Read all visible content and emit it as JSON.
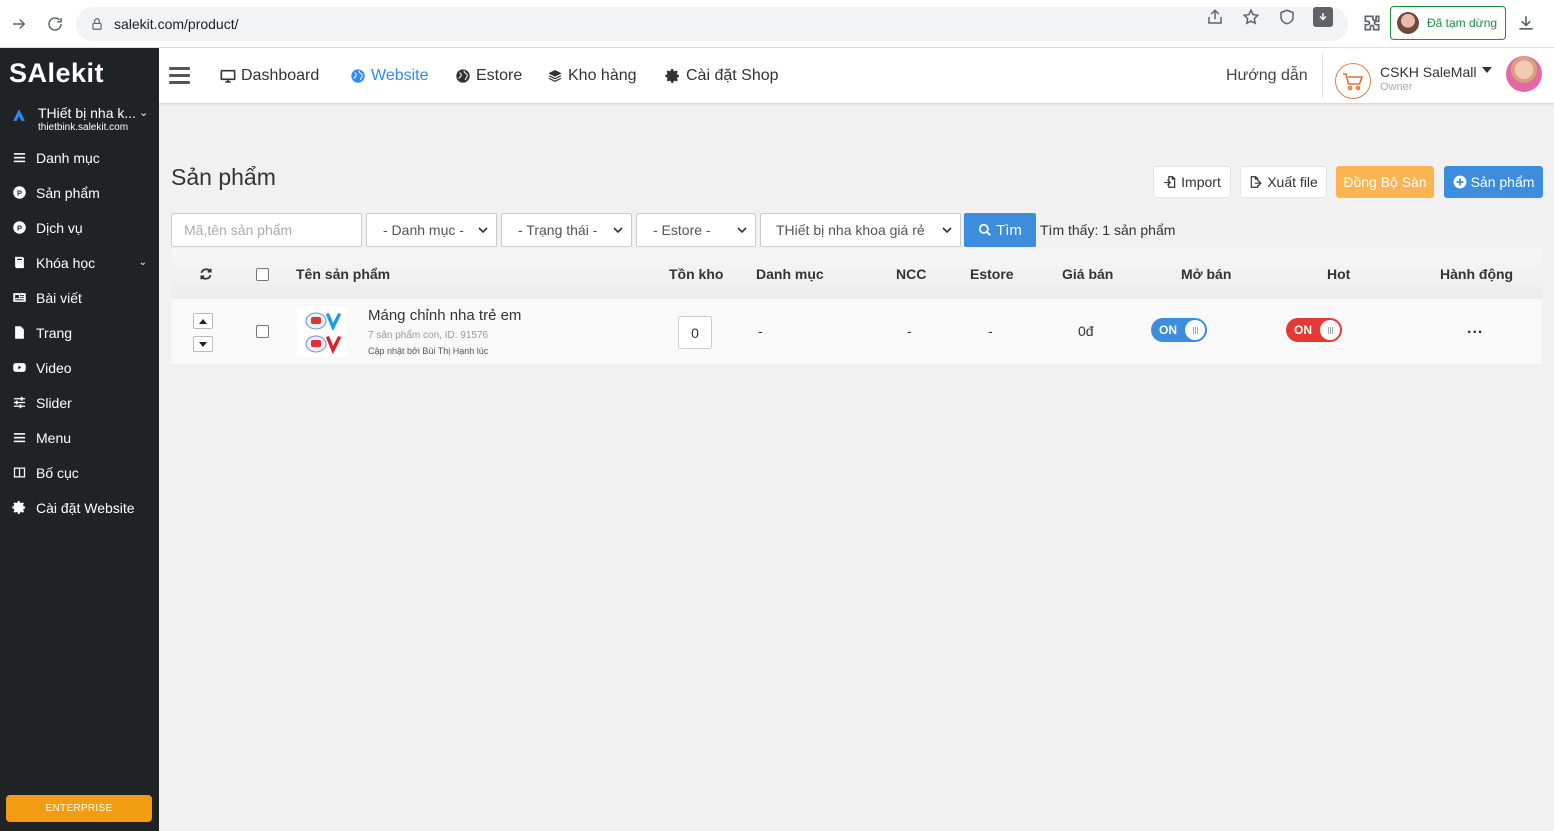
{
  "browser": {
    "url": "salekit.com/product/",
    "paused_label": "Đã tạm dừng"
  },
  "sidebar": {
    "logo": "SAlekit",
    "site_name": "THiết bị nha k...",
    "site_domain": "thietbink.salekit.com",
    "items": [
      {
        "label": "Danh mục",
        "icon": "list-icon"
      },
      {
        "label": "Sản phẩm",
        "icon": "product-icon"
      },
      {
        "label": "Dịch vụ",
        "icon": "service-icon"
      },
      {
        "label": "Khóa học",
        "icon": "course-icon"
      },
      {
        "label": "Bài viết",
        "icon": "article-icon"
      },
      {
        "label": "Trang",
        "icon": "page-icon"
      },
      {
        "label": "Video",
        "icon": "video-icon"
      },
      {
        "label": "Slider",
        "icon": "slider-icon"
      },
      {
        "label": "Menu",
        "icon": "menu-icon"
      },
      {
        "label": "Bố cục",
        "icon": "layout-icon"
      },
      {
        "label": "Cài đặt Website",
        "icon": "gear-icon"
      }
    ],
    "plan_badge": "ENTERPRISE"
  },
  "topnav": {
    "items": [
      {
        "label": "Dashboard",
        "icon": "monitor-icon"
      },
      {
        "label": "Website",
        "icon": "globe-icon",
        "active": true
      },
      {
        "label": "Estore",
        "icon": "globe-icon"
      },
      {
        "label": "Kho hàng",
        "icon": "layers-icon"
      },
      {
        "label": "Cài đặt Shop",
        "icon": "gear-icon"
      }
    ],
    "guide": "Hướng dẫn",
    "account_name": "CSKH SaleMall",
    "account_role": "Owner"
  },
  "main": {
    "title": "Sản phẩm",
    "buttons": {
      "import": "Import",
      "export": "Xuất file",
      "sync": "Đồng Bộ Sàn",
      "add_product": "Sản phẩm"
    },
    "filters": {
      "search_placeholder": "Mã,tên sản phẩm",
      "category": "- Danh mục -",
      "status": "- Trạng thái -",
      "estore": "- Estore -",
      "site": "THiết bị nha khoa giá rẻ",
      "search_button": "Tìm"
    },
    "found_label": "Tìm thấy:",
    "found_count": "1",
    "found_unit": "sản phẩm",
    "table": {
      "headers": {
        "name": "Tên sản phẩm",
        "stock": "Tồn kho",
        "category": "Danh mục",
        "supplier": "NCC",
        "estore": "Estore",
        "price": "Giá bán",
        "on_sale": "Mở bán",
        "hot": "Hot",
        "actions": "Hành động"
      },
      "rows": [
        {
          "name": "Máng chỉnh nha trẻ em",
          "meta": "7 sản phẩm con, ID: 91576",
          "updated": "Cập nhật bởi Bùi Thị Hạnh lúc",
          "stock": "0",
          "category": "-",
          "supplier": "-",
          "estore": "-",
          "price": "0đ",
          "on_sale": "ON",
          "hot": "ON",
          "actions": "..."
        }
      ]
    }
  },
  "colors": {
    "sidebar_bg": "#1f2326",
    "accent_blue": "#3c8dde",
    "orange": "#fbb450",
    "toggle_red": "#e53935",
    "enterprise_orange": "#f39c12"
  }
}
